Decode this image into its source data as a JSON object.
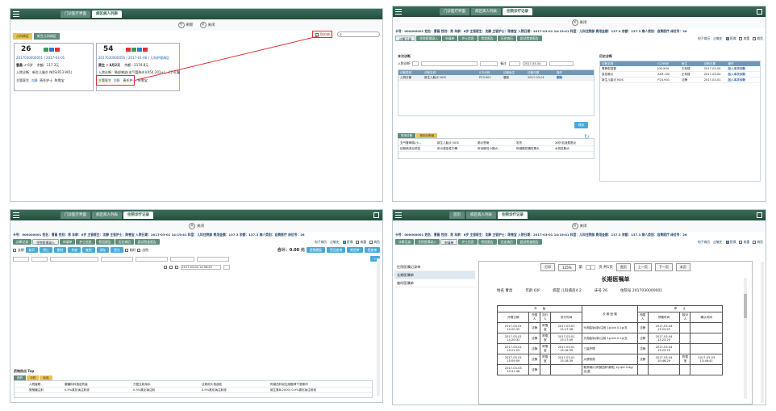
{
  "colors": {
    "topbar": "#2f5e4c",
    "accent": "#48a8d8",
    "highlight": "#e03030"
  },
  "p1": {
    "tabs": [
      "门诊医疗界面",
      "病区病人列表"
    ],
    "actions": [
      "刷新",
      "关闭"
    ],
    "wards": [
      "儿科病区",
      "新生儿科病区"
    ],
    "filter_label": "我的病人",
    "cards": [
      {
        "bed": "26",
        "id": "2017030000001",
        "date": "2017-03-01",
        "name": "曹昌",
        "age": "6岁",
        "balance": "余额：117.3元",
        "diag": "入院诊断：新生儿脑炎 NOS(P23.901)",
        "doctor": "主管医生",
        "d1": "沈静",
        "nurse": "责任护士",
        "n1": "陈雪宝"
      },
      {
        "bed": "54",
        "id": "2017030000056",
        "date": "2017-01-06",
        "dept": "儿科护理病区",
        "name": "黄生",
        "age": "4月2天",
        "balance": "余额：2174.8元",
        "diag": "入院诊断：肺部感染(支气管肺炎)(A54.201+)，/汀/孔腹",
        "doctor": "主管医生",
        "d1": "沈静",
        "nurse": "责任护士",
        "n1": "陈雪宝"
      }
    ]
  },
  "p2": {
    "tabs": [
      "门诊医疗界面",
      "病区病人列表",
      "住院诊疗记录"
    ],
    "actions": [
      "关闭"
    ],
    "info": "卡号：000000001 姓名：曹昌 性别：男 年龄：6岁 主管医生：沈静 主管护士：陈雪宝 入院日期：2017-03-01 14:19:41 科室：儿科住院部 费用金额：137.3 余额：137.3 病人类别：自费医疗 床位号：26",
    "subtabs": [
      "诊断记录",
      "住院医嘱录入",
      "申请单",
      "护士信息",
      "检验报告",
      "历史病历",
      "超试检查报告"
    ],
    "right_ctrls": [
      "电子病历",
      "过敏史",
      "医嘱",
      "病重",
      "病危"
    ],
    "left_section": "本次诊断",
    "right_section": "历史诊断",
    "form": {
      "label1": "入院诊断",
      "label2": "备注",
      "date": "2017-03-04"
    },
    "left_cols": [
      "诊断类别",
      "诊断名称",
      "ICD代码",
      "诊断医生",
      "诊断日期",
      "操作"
    ],
    "left_rows": [
      [
        "入院诊断",
        "新生儿脑炎 NOS",
        "P23.901",
        "唐新",
        "2017-03-01",
        "删除"
      ]
    ],
    "right_cols": [
      "诊断名称",
      "ICD代码",
      "医生",
      "诊断日期",
      "操作"
    ],
    "right_rows": [
      [
        "胃肠型感冒",
        "J00.X04",
        "王科楼",
        "2017-03-04",
        "加入本次诊断"
      ],
      [
        "急性喉炎",
        "A09.100",
        "王科楼",
        "2017-03-04",
        "加入本次诊断"
      ],
      [
        "新生儿脑炎 NOS",
        "P23.901",
        "沈静",
        "2017-03-01",
        "加入本次诊断"
      ]
    ],
    "save_label": "保存",
    "bottom_tabs": [
      "常用诊断",
      "常用诊断组"
    ],
    "bottom_rows": [
      [
        "支气管哮喘(小...",
        "新生儿脑炎 NOS",
        "肺炎恶病",
        "发热",
        "冰疗/血液肌筋炎"
      ],
      [
        "结核病变后肝癌",
        "肝炎感染性中毒",
        "肝动脉性小肠炎...",
        "肝细胞贫痛性胃炎",
        "水的性胸炎"
      ]
    ]
  },
  "p3": {
    "tabs": [
      "门诊医疗界面",
      "病区病人列表",
      "住院诊疗记录"
    ],
    "actions": [
      "关闭"
    ],
    "info": "卡号：000000001 姓名：曹昌 性别：男 年龄：6岁 主管医生：沈静 主管护士：陈雪宝 入院日期：2017-03-01 14:19:41 科室：儿科住院部 费用金额：137.3 余额：137.3 病人类别：自费医疗 床位号：26",
    "subtabs": [
      "诊断记录",
      "住院医嘱录入",
      "申请单",
      "护士信息",
      "检验报告",
      "历史病历",
      "超试检查报告"
    ],
    "right_ctrls": [
      "电子病历",
      "过敏史",
      "医嘱",
      "病重",
      "病危"
    ],
    "toolbar": [
      "新开",
      "停止",
      "删除",
      "作废",
      "复制",
      "保存",
      "提交",
      "医嘱模板",
      "药品查询",
      "检验单",
      "检查单"
    ],
    "total": "合计：0.00 元",
    "checks": [
      "长期",
      "临时",
      "出院"
    ],
    "date": "2017-03-04 14:56:29",
    "bottom_title": "药物热点 Top",
    "bottom_tabs": [
      "西药",
      "中药",
      "检验"
    ],
    "bottom_rows": [
      [
        "入院催眠",
        "腺糖料科指定药量",
        "万复注射用水",
        "注射用头孢曲松",
        "阿莫西林克拉维酸钾干混悬剂"
      ],
      [
        "葡萄糖注射",
        "0.9%氯化钠注射液",
        "0.9%氯化钠注射",
        "0.9%氯化钠注射液",
        "维生素B(2000) 0.9%氯化钠注射液"
      ]
    ]
  },
  "p4": {
    "tabs": [
      "首页",
      "病区病人列表",
      "住院诊疗记录"
    ],
    "actions": [
      "关闭"
    ],
    "info": "卡号：000000001 姓名：曹昌 性别：男 年龄：6岁 主管医生：沈静 主管护士：陈雪宝 入院日期：2017-03-01 14:19:41 科室：儿科住院部 费用金额：137.3 余额：137.3 病人类别：自费医疗 床位号：26",
    "subtabs": [
      "诊断记录",
      "住院医嘱录入",
      "申请单",
      "护士信息",
      "检验报告",
      "历史病历",
      "超试检查报告"
    ],
    "right_ctrls": [
      "电子病历",
      "过敏史",
      "医嘱",
      "病重",
      "病危"
    ],
    "nav": [
      "住院医嘱记录单",
      "长期医嘱单",
      "临时医嘱单"
    ],
    "doc_toolbar": {
      "print": "打印",
      "zoom": "125%",
      "page_label": "第",
      "page": "1",
      "total": "页 共1页",
      "first": "首页",
      "prev": "上一页",
      "next": "下一页",
      "last": "末页"
    },
    "doc_title": "长期医嘱单",
    "doc_info": [
      "姓名 曹昌",
      "年龄 6岁",
      "病室 儿科病房4.2",
      "床号 26",
      "住院号 2017030000001"
    ],
    "col_groups": [
      "开　　始",
      "停　　止"
    ],
    "cols": [
      "开嘱日期",
      "开嘱人",
      "执行人",
      "执行时间",
      "长  期  医  嘱",
      "停嘱人",
      "停嘱时间",
      "核对人",
      "确认时间"
    ],
    "rows": [
      [
        "2017-03-01 14:20:32",
        "沈静",
        "陈雪宝",
        "2017-03-01 15:17:36",
        "头孢曲钠(新)注射 1g bid 0.1g/支",
        "沈静",
        "2017-03-04 13:23:25",
        "",
        ""
      ],
      [
        "2017-03-01 14:20:32",
        "沈静",
        "陈雪宝",
        "2017-03-01 15:17:49",
        "头孢曲钠(新)注射 1g bid 0.1g/支",
        "沈静",
        "2017-03-04 13:23:25",
        "",
        ""
      ],
      [
        "2017-03-01 14:21:25",
        "沈静",
        "陈雪宝",
        "2017-03-01 15:18:39",
        "三级护理",
        "沈静",
        "2017-03-04 13:23:25",
        "",
        ""
      ],
      [
        "2017-03-01 15:09:09",
        "沈静",
        "陈雪宝",
        "2017-03-01 15:18:39",
        "大便常规",
        "沈静",
        "2017-03-04 10:46:29",
        "陈雪宝",
        "2017-03-03 13:46:41"
      ],
      [
        "2017-03-03 15:41:48",
        "沈静",
        "",
        "",
        "氨茶碱片(阿莫西林)颗粒 1g qid 0.6g/支/盒",
        "",
        "",
        "",
        ""
      ]
    ]
  }
}
